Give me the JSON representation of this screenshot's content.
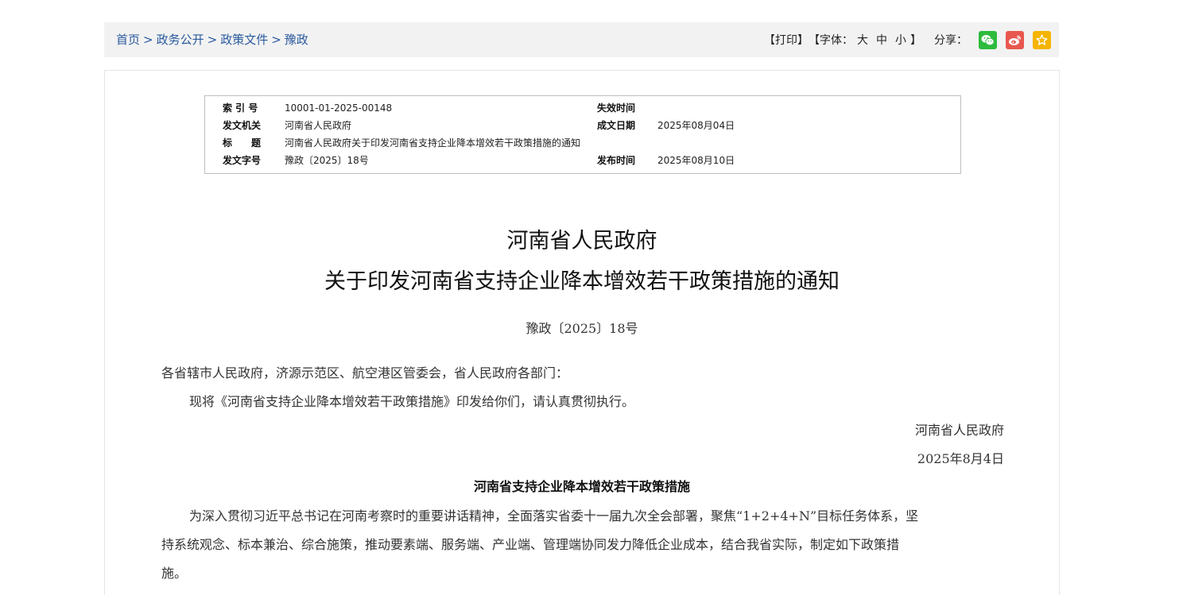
{
  "breadcrumb": {
    "items": [
      "首页",
      "政务公开",
      "政策文件",
      "豫政"
    ],
    "separator": ">"
  },
  "toolbar": {
    "print": "【打印】",
    "font_label": "【字体：",
    "font_large": "大",
    "font_medium": "中",
    "font_small": "小",
    "font_close": "】",
    "share_label": "分享："
  },
  "meta": {
    "index_label": "索 引 号",
    "index_value": "10001-01-2025-00148",
    "expire_label": "失效时间",
    "expire_value": "",
    "issuer_label": "发文机关",
    "issuer_value": "河南省人民政府",
    "created_label": "成文日期",
    "created_value": "2025年08月04日",
    "title_label": "标　　题",
    "title_value": "河南省人民政府关于印发河南省支持企业降本增效若干政策措施的通知",
    "docno_label": "发文字号",
    "docno_value": "豫政〔2025〕18号",
    "publish_label": "发布时间",
    "publish_value": "2025年08月10日"
  },
  "article": {
    "title_line1": "河南省人民政府",
    "title_line2": "关于印发河南省支持企业降本增效若干政策措施的通知",
    "doc_number": "豫政〔2025〕18号",
    "salutation": "各省辖市人民政府，济源示范区、航空港区管委会，省人民政府各部门：",
    "body1": "现将《河南省支持企业降本增效若干政策措施》印发给你们，请认真贯彻执行。",
    "signature": "河南省人民政府",
    "date": "2025年8月4日",
    "subtitle": "河南省支持企业降本增效若干政策措施",
    "para_line1": "为深入贯彻习近平总书记在河南考察时的重要讲话精神，全面落实省委十一届九次全会部署，聚焦“1+2+4+N”目标任务体系，坚",
    "para_line2": "持系统观念、标本兼治、综合施策，推动要素端、服务端、产业端、管理端协同发力降低企业成本，结合我省实际，制定如下政策措",
    "para_line3": "施。"
  },
  "colors": {
    "link": "#2b5a9e",
    "wechat": "#2dbb3c",
    "weibo": "#e8574e",
    "favorite": "#f5b400"
  }
}
